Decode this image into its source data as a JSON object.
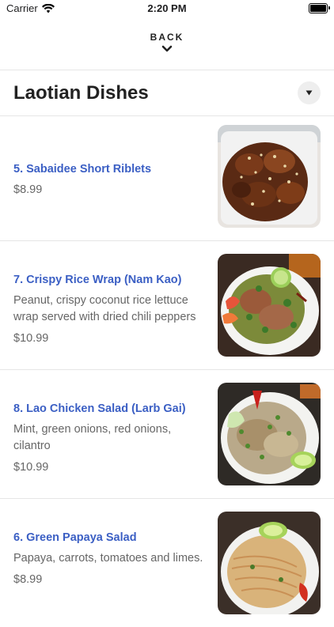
{
  "status_bar": {
    "carrier": "Carrier",
    "time": "2:20 PM"
  },
  "nav": {
    "back_label": "BACK"
  },
  "section": {
    "title": "Laotian Dishes"
  },
  "items": [
    {
      "name": "5. Sabaidee Short Riblets",
      "description": "",
      "price": "$8.99",
      "image": "fried-riblets-photo"
    },
    {
      "name": "7. Crispy Rice Wrap (Nam Kao)",
      "description": "Peanut, crispy coconut rice lettuce wrap served with dried chili peppers",
      "price": "$10.99",
      "image": "nam-kao-photo"
    },
    {
      "name": "8. Lao Chicken Salad (Larb Gai)",
      "description": "Mint, green onions, red onions, cilantro",
      "price": "$10.99",
      "image": "larb-gai-photo"
    },
    {
      "name": "6. Green Papaya Salad",
      "description": "Papaya, carrots, tomatoes and limes.",
      "price": "$8.99",
      "image": "papaya-salad-photo"
    }
  ]
}
